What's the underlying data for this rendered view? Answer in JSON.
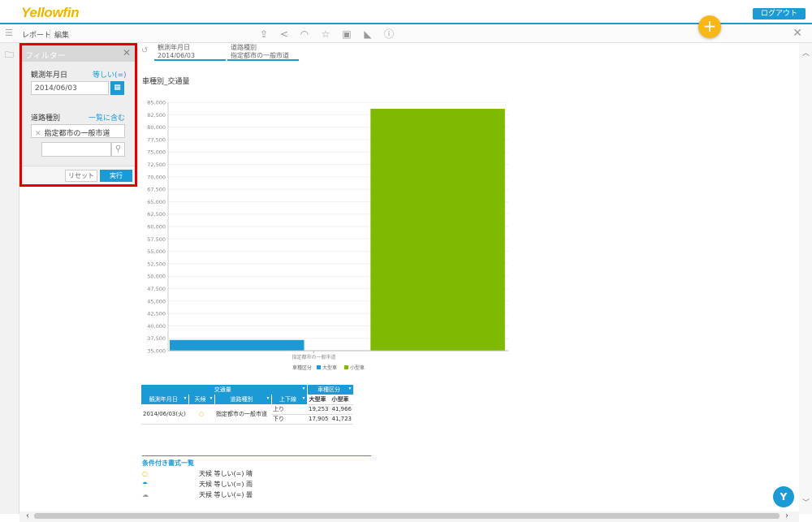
{
  "header": {
    "logo": "Yellowfin",
    "logout": "ログアウト"
  },
  "toolbar": {
    "menu_icon": "menu-icon",
    "report": "レポート",
    "edit": "編集"
  },
  "filter_panel": {
    "title": "フィルター",
    "field1_label": "観測年月日",
    "field1_op": "等しい(=)",
    "field1_value": "2014/06/03",
    "field2_label": "道路種別",
    "field2_op": "一覧に含む",
    "field2_tag": "指定都市の一般市道",
    "reset": "リセット",
    "run": "実行"
  },
  "chips": [
    {
      "label": "観測年月日",
      "value": "2014/06/03"
    },
    {
      "label": "道路種別",
      "value": "指定都市の一般市道"
    }
  ],
  "chart_data": {
    "type": "bar",
    "title": "車種別_交通量",
    "categories": [
      "指定都市の一般市道"
    ],
    "series": [
      {
        "name": "大型車",
        "values": [
          37158
        ],
        "color": "#1b9ad6"
      },
      {
        "name": "小型車",
        "values": [
          83689
        ],
        "color": "#7fba00"
      }
    ],
    "ylim": [
      35000,
      85000
    ],
    "yticks": [
      "85,000",
      "82,500",
      "80,000",
      "77,500",
      "75,000",
      "72,500",
      "70,000",
      "67,500",
      "65,000",
      "62,500",
      "60,000",
      "57,500",
      "55,000",
      "52,500",
      "50,000",
      "47,500",
      "45,000",
      "42,500",
      "40,000",
      "37,500",
      "35,000"
    ],
    "legend_title": "車種区分",
    "legend_position": "bottom"
  },
  "table": {
    "group1": "交通量",
    "group2": "車種区分",
    "headers": [
      "観測年月日",
      "天候",
      "道路種別",
      "上下線",
      "大型車",
      "小型車"
    ],
    "date": "2014/06/03(火)",
    "road": "指定都市の一般市道",
    "rows": [
      {
        "dir": "上り",
        "large": "19,253",
        "small": "41,966"
      },
      {
        "dir": "下り",
        "large": "17,905",
        "small": "41,723"
      }
    ]
  },
  "conditional_formats": {
    "title": "条件付き書式一覧",
    "items": [
      {
        "icon": "sun-icon",
        "text": "天候 等しい(=) 晴"
      },
      {
        "icon": "umbrella-icon",
        "text": "天候 等しい(=) 雨"
      },
      {
        "icon": "cloud-icon",
        "text": "天候 等しい(=) 曇"
      }
    ]
  },
  "colors": {
    "accent": "#1b9ad6",
    "highlight": "#e00000",
    "fab": "#f8b714"
  }
}
